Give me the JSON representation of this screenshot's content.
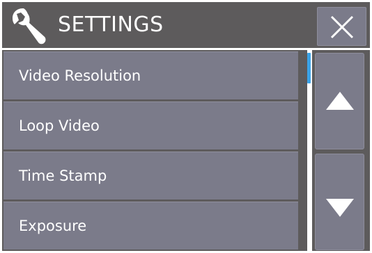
{
  "header": {
    "icon": "wrench-icon",
    "title": "SETTINGS",
    "close_icon": "close-icon"
  },
  "menu": {
    "items": [
      {
        "label": "Video Resolution"
      },
      {
        "label": "Loop Video"
      },
      {
        "label": "Time Stamp"
      },
      {
        "label": "Exposure"
      }
    ]
  },
  "scrollbar": {
    "position": 0
  },
  "nav": {
    "up_icon": "triangle-up-icon",
    "down_icon": "triangle-down-icon"
  },
  "colors": {
    "panel_bg": "#5d5b5c",
    "item_bg": "#7b7b8a",
    "text": "#ffffff",
    "scroll_thumb": "#3aa3e8"
  }
}
